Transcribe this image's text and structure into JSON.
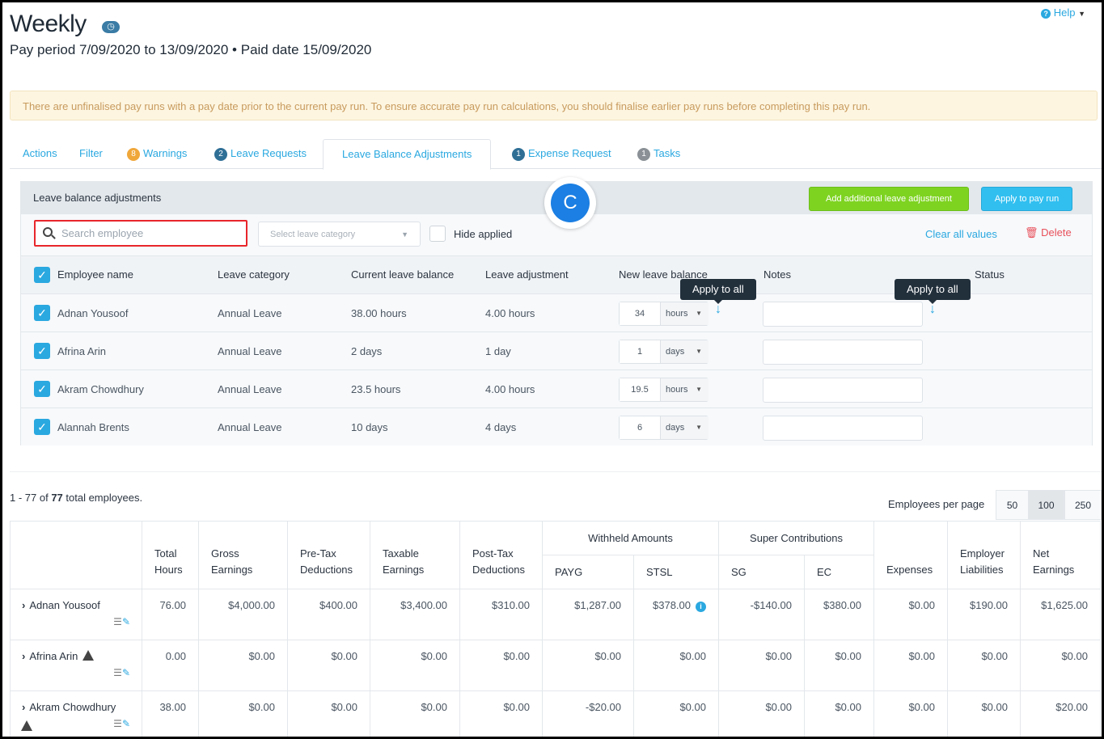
{
  "header": {
    "title": "Weekly",
    "clock_icon": "clock-icon",
    "subtitle": "Pay period 7/09/2020 to 13/09/2020 • Paid date 15/09/2020",
    "help": "Help"
  },
  "banner": "There are unfinalised pay runs with a pay date prior to the current pay run. To ensure accurate pay run calculations, you should finalise earlier pay runs before completing this pay run.",
  "tabs": [
    {
      "label": "Actions"
    },
    {
      "label": "Filter"
    },
    {
      "label": "Warnings",
      "badge": "8",
      "badge_color": "#f0a73a"
    },
    {
      "label": "Leave Requests",
      "badge": "2",
      "badge_color": "#2f6f96"
    },
    {
      "label": "Leave Balance Adjustments",
      "active": true
    },
    {
      "label": "Expense Request",
      "badge": "1",
      "badge_color": "#2f6f96"
    },
    {
      "label": "Tasks",
      "badge": "1",
      "badge_color": "#8a9096"
    }
  ],
  "panel": {
    "title": "Leave balance adjustments",
    "add_button": "Add additional leave adjustment",
    "apply_button": "Apply to pay run",
    "search_placeholder": "Search employee",
    "category_placeholder": "Select leave category",
    "hide_applied": "Hide applied",
    "clear_all": "Clear all values",
    "delete": "Delete",
    "marker": "C",
    "tooltip": "Apply to all",
    "columns": [
      "Employee name",
      "Leave category",
      "Current leave balance",
      "Leave adjustment",
      "New leave balance",
      "Notes",
      "Status"
    ],
    "rows": [
      {
        "name": "Adnan Yousoof",
        "category": "Annual Leave",
        "current": "38.00 hours",
        "adjustment": "4.00 hours",
        "new_value": "34",
        "unit": "hours",
        "checked": true
      },
      {
        "name": "Afrina Arin",
        "category": "Annual Leave",
        "current": "2 days",
        "adjustment": "1 day",
        "new_value": "1",
        "unit": "days",
        "checked": true
      },
      {
        "name": "Akram Chowdhury",
        "category": "Annual Leave",
        "current": "23.5 hours",
        "adjustment": "4.00 hours",
        "new_value": "19.5",
        "unit": "hours",
        "checked": true
      },
      {
        "name": "Alannah Brents",
        "category": "Annual Leave",
        "current": "10 days",
        "adjustment": "4 days",
        "new_value": "6",
        "unit": "days",
        "checked": true
      }
    ]
  },
  "summary": {
    "range": "1 - 77 of ",
    "count": "77",
    "suffix": " total employees.",
    "per_page_label": "Employees per page",
    "per_page_options": [
      "50",
      "100",
      "250"
    ],
    "per_page_selected": "100"
  },
  "table": {
    "groups": {
      "withheld": "Withheld Amounts",
      "super": "Super Contributions"
    },
    "headers": {
      "total_hours": "Total Hours",
      "gross": "Gross Earnings",
      "pretax": "Pre-Tax Deductions",
      "taxable": "Taxable Earnings",
      "posttax": "Post-Tax Deductions",
      "payg": "PAYG",
      "stsl": "STSL",
      "sg": "SG",
      "ec": "EC",
      "expenses": "Expenses",
      "employer": "Employer Liabilities",
      "net": "Net Earnings"
    },
    "rows": [
      {
        "name": "Adnan Yousoof",
        "warning": false,
        "values": [
          "76.00",
          "$4,000.00",
          "$400.00",
          "$3,400.00",
          "$310.00",
          "$1,287.00",
          "$378.00",
          "-$140.00",
          "$380.00",
          "$0.00",
          "$190.00",
          "$1,625.00"
        ],
        "stsl_info": true
      },
      {
        "name": "Afrina Arin",
        "warning": true,
        "values": [
          "0.00",
          "$0.00",
          "$0.00",
          "$0.00",
          "$0.00",
          "$0.00",
          "$0.00",
          "$0.00",
          "$0.00",
          "$0.00",
          "$0.00",
          "$0.00"
        ]
      },
      {
        "name": "Akram Chowdhury",
        "warning": true,
        "values": [
          "38.00",
          "$0.00",
          "$0.00",
          "$0.00",
          "$0.00",
          "-$20.00",
          "$0.00",
          "$0.00",
          "$0.00",
          "$0.00",
          "$0.00",
          "$20.00"
        ]
      }
    ]
  },
  "colors": {
    "accent": "#2aa8e0",
    "green": "#7ed321",
    "delete": "#e8505b",
    "highlight": "#e8262b"
  }
}
